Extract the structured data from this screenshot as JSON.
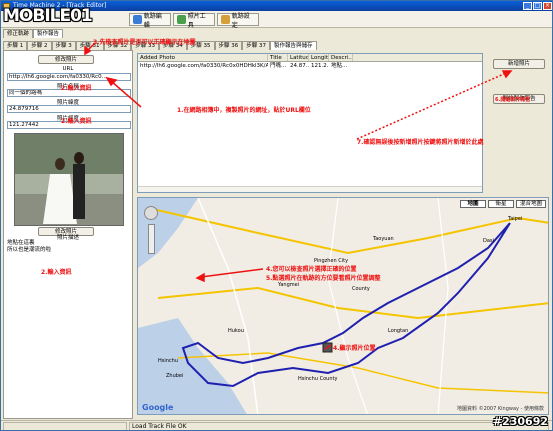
{
  "watermark": {
    "logo_text": "MOBILE01",
    "post_id": "#230692"
  },
  "titlebar": {
    "title": "Time Machine 2 - [Track Editor]"
  },
  "toolbar": {
    "buttons": [
      {
        "label": "軌跡編輯",
        "color": "#3a7bd5"
      },
      {
        "label": "照片工具",
        "color": "#4aa04a"
      },
      {
        "label": "軌跡設定",
        "color": "#d5a03a"
      }
    ]
  },
  "left": {
    "tabs_top": [
      {
        "label": "修正軌跡"
      },
      {
        "label": "製作報告"
      }
    ],
    "tabs_steps": [
      {
        "label": "步驟 1"
      },
      {
        "label": "步驟 2"
      },
      {
        "label": "步驟 3"
      },
      {
        "label": "步驟 31"
      },
      {
        "label": "步驟 32"
      },
      {
        "label": "步驟 33"
      },
      {
        "label": "步驟 34"
      },
      {
        "label": "步驟 35"
      },
      {
        "label": "步驟 36"
      },
      {
        "label": "步驟 37"
      },
      {
        "label": "製作報告與儲存"
      }
    ],
    "edit_photo_button": "修改照片",
    "url_label": "URL",
    "url_value": "http://lh6.google.com/fa0330/Rc0...",
    "photo_name_label": "照片名稱",
    "photo_name_value": "同一個的路嗎",
    "lat_label": "照片緯度",
    "lat_value": "24.879716",
    "lon_label": "照片經度",
    "lon_value": "121.27442",
    "add_photo_button": "修改照片",
    "desc_label": "照片描述",
    "desc_text": "地點在這裏\n所以也是潮流的啦"
  },
  "table": {
    "columns": [
      {
        "label": "Added Photo",
        "width": 130
      },
      {
        "label": "Title",
        "width": 20
      },
      {
        "label": "Latitude",
        "width": 21
      },
      {
        "label": "Longit...",
        "width": 20
      },
      {
        "label": "Descri...",
        "width": 24
      }
    ],
    "rows": [
      {
        "cells": [
          "http://lh6.google.com/fa0330/Rc0x0HDHkl3K/AAAAAAAA...",
          "門嘴...",
          "24.87...",
          "121.2...",
          "地點..."
        ]
      }
    ]
  },
  "right_buttons": {
    "add_photo": "新增照片",
    "start_report": "開始製作報告"
  },
  "map": {
    "types": [
      {
        "label": "地圖",
        "selected": true
      },
      {
        "label": "衛星",
        "selected": false
      },
      {
        "label": "混合地圖",
        "selected": false
      }
    ],
    "place_labels": [
      "Taipei",
      "Taoyuan",
      "Hsinchu",
      "County",
      "Pingzhen City",
      "Yangmei",
      "Longtan",
      "Dasi",
      "Hukou",
      "Hsinchu County",
      "Zhubei"
    ],
    "google_logo": "Google",
    "copyright": "地圖資料 ©2007 Kingway - 使用條款"
  },
  "annotations": {
    "a1": "1.在網路相簿中，複製照片的網址，貼於URL欄位",
    "a2": "2.輸入資訊",
    "a3": "3.先檢查照片是否可以正確顯示在地圖",
    "a4": "2.輸入資訊",
    "a5": "2.輸入資訊",
    "a6": "6.開始製作報告",
    "a7": "7.確認無誤後按新增照片按鍵將照片新增於此處",
    "a8": "4.您可以檢查照片選擇正確的位置",
    "a9": "5.點選照片在軌跡的方位要看照片位置調整",
    "a10": "4.顯示照片位置"
  },
  "status": {
    "left": "",
    "center": "Load Track File OK"
  }
}
